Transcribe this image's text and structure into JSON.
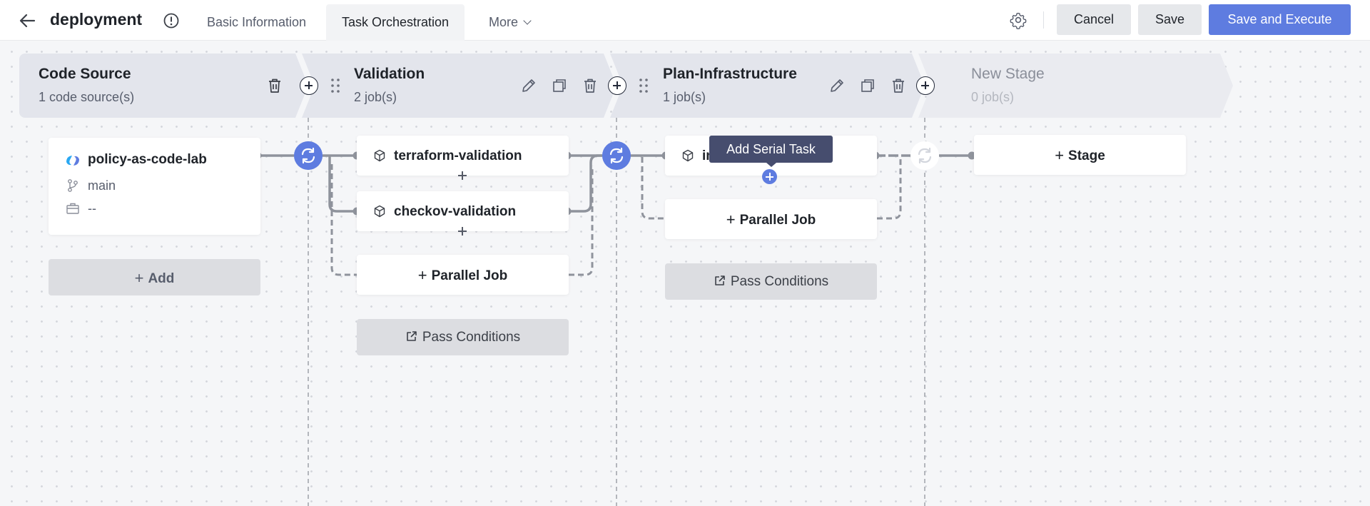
{
  "header": {
    "title": "deployment",
    "tabs": [
      {
        "label": "Basic Information",
        "active": false
      },
      {
        "label": "Task Orchestration",
        "active": true
      },
      {
        "label": "More",
        "active": false
      }
    ],
    "buttons": {
      "cancel": "Cancel",
      "save": "Save",
      "save_execute": "Save and Execute"
    }
  },
  "colors": {
    "primary": "#5e7ce0",
    "stage_header": "#e3e5ec",
    "tooltip": "#464d6e"
  },
  "stages": [
    {
      "name": "Code Source",
      "subtitle": "1 code source(s)",
      "source": {
        "name": "policy-as-code-lab",
        "branch": "main",
        "value": "--"
      },
      "add_label": "Add"
    },
    {
      "name": "Validation",
      "subtitle": "2 job(s)",
      "jobs": [
        "terraform-validation",
        "checkov-validation"
      ],
      "parallel_label": "Parallel Job",
      "pass_label": "Pass Conditions"
    },
    {
      "name": "Plan-Infrastructure",
      "subtitle": "1 job(s)",
      "jobs": [
        "in..."
      ],
      "parallel_label": "Parallel Job",
      "pass_label": "Pass Conditions"
    },
    {
      "name": "New Stage",
      "subtitle": "0 job(s)",
      "stage_btn": "Stage"
    }
  ],
  "tooltip": "Add Serial Task",
  "icons": [
    "back-arrow-icon",
    "info-icon",
    "gear-icon",
    "trash-icon",
    "edit-icon",
    "copy-icon",
    "drag-handle-icon",
    "plus-icon",
    "branch-icon",
    "briefcase-icon",
    "job-cube-icon",
    "share-icon",
    "refresh-connector-icon"
  ]
}
